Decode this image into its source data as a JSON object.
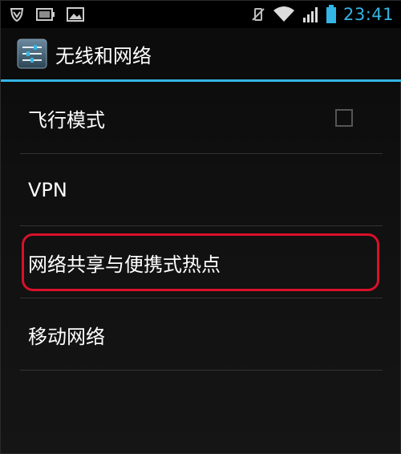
{
  "status_bar": {
    "left_icons": [
      "shield-icon",
      "battery-charging-icon",
      "image-icon"
    ],
    "right_icons": [
      "vibrate-silent-icon",
      "wifi-icon",
      "signal-icon",
      "battery-icon"
    ],
    "time": "23:41"
  },
  "action_bar": {
    "icon": "settings-sliders-icon",
    "title": "无线和网络"
  },
  "settings": {
    "items": [
      {
        "label": "飞行模式",
        "has_checkbox": true,
        "checked": false
      },
      {
        "label": "VPN"
      },
      {
        "label": "网络共享与便携式热点",
        "highlighted": true
      },
      {
        "label": "移动网络"
      }
    ]
  },
  "colors": {
    "accent": "#33b5e5",
    "highlight": "#d9102a",
    "text": "#ffffff",
    "background": "#0f0f0f"
  }
}
